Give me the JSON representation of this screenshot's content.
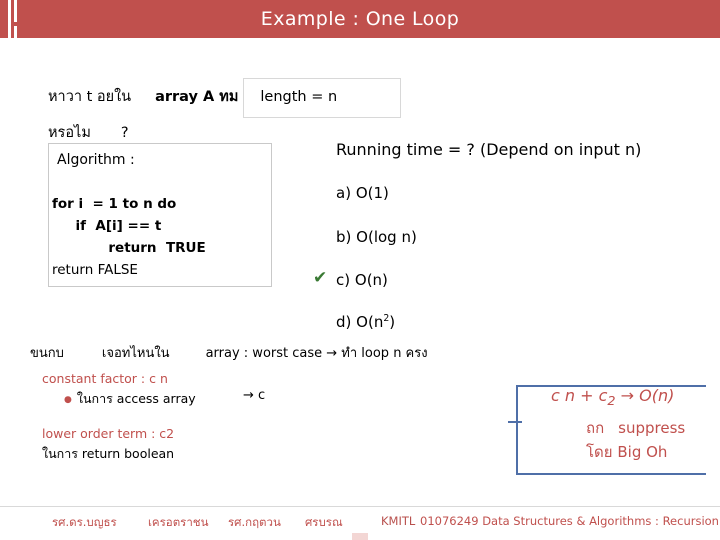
{
  "slide": {
    "title": "Example : One Loop",
    "question": {
      "part1": "หาวา  t อยใน",
      "part2": "array A ทม",
      "part3": "length = n",
      "part4": "หรอไม",
      "qmark": "?"
    },
    "algorithm": {
      "label": "Algorithm :",
      "lines": [
        "for i  = 1 to n do",
        "     if  A[i] == t",
        "            return  TRUE",
        "return FALSE"
      ]
    },
    "running_time": "Running time = ?  (Depend on input n)",
    "options": [
      {
        "key": "a)",
        "text": "O(1)",
        "checked": false
      },
      {
        "key": "b)",
        "text": "O(log n)",
        "checked": false
      },
      {
        "key": "c)",
        "text": "O(n)",
        "checked": true
      },
      {
        "key": "d)",
        "text": "O(n",
        "sup": "2",
        "suffix": ")",
        "checked": false
      }
    ],
    "check_mark": "✔",
    "notes": {
      "row": {
        "n1": "ขนกบ",
        "n2": "เจอทไหนใน",
        "n3": "array : worst case → ทำ   loop  n ครง"
      },
      "constant_factor": "constant factor :  c n",
      "constant_sub": "ในการ access array",
      "constant_arrow": "→ c",
      "lower_order": "lower order term :  c2",
      "lower_sub": "ในการ return boolean"
    },
    "callout": {
      "equation_a": "c n + c",
      "equation_sub": "2",
      "equation_b": " → O(n)",
      "line2_a": "ถก",
      "line2_b": "suppress",
      "line3": "โดย Big Oh"
    },
    "footer": {
      "item1": "รศ.ดร.บญธร",
      "item2": "เครอตราชน",
      "item3": "รศ.กฤตวน",
      "item4": "ศรบรณ",
      "item5": "KMITL",
      "item6": "01076249 Data Structures & Algorithms : Recursion"
    }
  },
  "colors": {
    "banner": "#c0504d",
    "accent_red": "#c0504d",
    "callout_blue": "#4f6fa8",
    "check_green": "#3a7a34"
  }
}
